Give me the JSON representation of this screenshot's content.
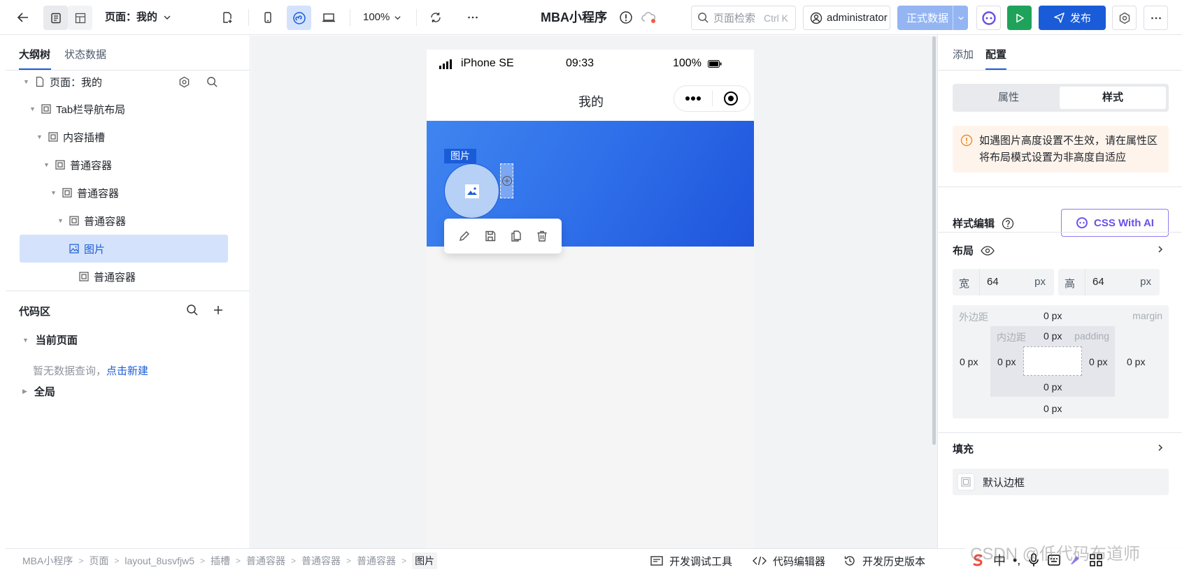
{
  "topbar": {
    "page_select": "页面：我的",
    "zoom": "100%",
    "app_name": "MBA小程序",
    "search_placeholder": "页面检索",
    "search_shortcut": "Ctrl K",
    "user": "administrator",
    "env": "正式数据",
    "publish": "发布"
  },
  "left": {
    "tabs": [
      "大纲树",
      "状态数据"
    ],
    "tree": [
      {
        "label": "页面：我的"
      },
      {
        "label": "Tab栏导航布局"
      },
      {
        "label": "内容插槽"
      },
      {
        "label": "普通容器"
      },
      {
        "label": "普通容器"
      },
      {
        "label": "普通容器"
      },
      {
        "label": "图片"
      },
      {
        "label": "普通容器"
      }
    ],
    "code_area": "代码区",
    "current_page": "当前页面",
    "empty_text": "暂无数据查询，",
    "empty_link": "点击新建",
    "global": "全局"
  },
  "phone": {
    "carrier": "iPhone SE",
    "time": "09:33",
    "battery": "100%",
    "title": "我的",
    "image_label": "图片"
  },
  "right": {
    "tabs": [
      "添加",
      "配置"
    ],
    "seg": [
      "属性",
      "样式"
    ],
    "warning": "如遇图片高度设置不生效，请在属性区将布局模式设置为非高度自适应",
    "style_edit": "样式编辑",
    "css_ai": "CSS With AI",
    "layout": "布局",
    "width_label": "宽",
    "width_value": "64",
    "height_label": "高",
    "height_value": "64",
    "unit": "px",
    "margin_label": "外边距",
    "margin_en": "margin",
    "padding_label": "内边距",
    "padding_en": "padding",
    "zero": "0 px",
    "fill": "填充",
    "default_border": "默认边框"
  },
  "bottom": {
    "crumbs": [
      "MBA小程序",
      "页面",
      "layout_8usvfjw5",
      "插槽",
      "普通容器",
      "普通容器",
      "普通容器",
      "图片"
    ],
    "dev_tools": "开发调试工具",
    "code_editor": "代码编辑器",
    "history": "开发历史版本"
  },
  "watermark": "CSDN @低代码布道师",
  "colors": {
    "primary": "#1a5cd8",
    "env": "#94b5f2",
    "run": "#1fa35a",
    "warn_bg": "#fff4ec"
  }
}
